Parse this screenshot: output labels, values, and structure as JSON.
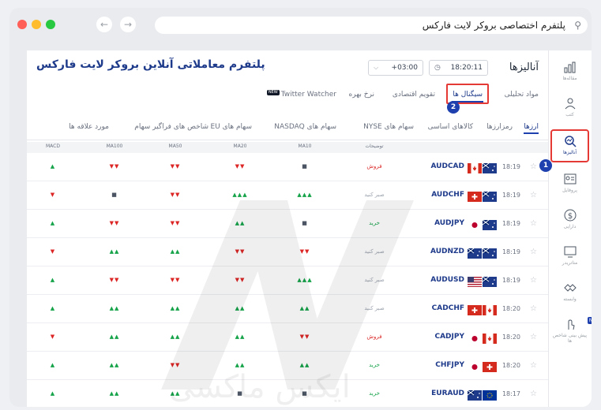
{
  "browser": {
    "url_text": "پلتفرم اختصاصی بروکر لایت فارکس",
    "dots": [
      "#ff5f57",
      "#febc2e",
      "#28c840"
    ]
  },
  "sidebar": {
    "items": [
      {
        "icon": "chart-bars-icon",
        "label": "مقاله‌ها"
      },
      {
        "icon": "book-icon",
        "label": "کتب"
      },
      {
        "icon": "analysis-icon",
        "label": "آنالیزها"
      },
      {
        "icon": "profile-card-icon",
        "label": "پروفایل"
      },
      {
        "icon": "dollar-coin-icon",
        "label": "دارایی"
      },
      {
        "icon": "monitor-icon",
        "label": "متاتریدر"
      },
      {
        "icon": "handshake-icon",
        "label": "وابسته"
      },
      {
        "icon": "touch-icon",
        "label": "پیش بینی شاخص ها"
      }
    ],
    "new_badge": "Ne",
    "step1": "1"
  },
  "header": {
    "title": "آنالیزها",
    "time": "18:20:11",
    "timezone": "03:00+",
    "brand": "پلتفرم معاملاتی آنلاین بروکر لایت فارکس"
  },
  "main_tabs": {
    "tabs": [
      "مواد تحلیلی",
      "سیگنال ها",
      "تقویم اقتصادی",
      "نرخ بهره",
      "Twitter Watcher"
    ],
    "new_label": "NEW",
    "step2": "2"
  },
  "sub_tabs": [
    "ارزها",
    "رمزارزها",
    "کالاهای اساسی",
    "سهام های NYSE",
    "سهام های NASDAQ",
    "سهام های EU",
    "شاخص های فراگیر سهام",
    "مورد علاقه ها"
  ],
  "table": {
    "headers": {
      "signal": "توضیحات",
      "ma10": "MA10",
      "ma20": "MA20",
      "ma50": "MA50",
      "ma100": "MA100",
      "macd": "MACD"
    },
    "rows": [
      {
        "time": "18:19",
        "symbol": "AUDCAD",
        "signal": "فروش",
        "ma10": "■",
        "ma20": "▼▼",
        "ma50": "▼▼",
        "ma100": "▼▼",
        "macd": "▲"
      },
      {
        "time": "18:19",
        "symbol": "AUDCHF",
        "signal": "صبر کنید",
        "ma10": "▲▲▲",
        "ma20": "▲▲▲",
        "ma50": "▼▼",
        "ma100": "■",
        "macd": "▼"
      },
      {
        "time": "18:19",
        "symbol": "AUDJPY",
        "signal": "خرید",
        "ma10": "■",
        "ma20": "▲▲",
        "ma50": "▼▼",
        "ma100": "▼▼",
        "macd": "▲"
      },
      {
        "time": "18:19",
        "symbol": "AUDNZD",
        "signal": "صبر کنید",
        "ma10": "▼▼",
        "ma20": "▼▼",
        "ma50": "▲▲",
        "ma100": "▲▲",
        "macd": "▼"
      },
      {
        "time": "18:19",
        "symbol": "AUDUSD",
        "signal": "صبر کنید",
        "ma10": "▲▲▲",
        "ma20": "▼▼",
        "ma50": "▼▼",
        "ma100": "▼▼",
        "macd": "▲"
      },
      {
        "time": "18:20",
        "symbol": "CADCHF",
        "signal": "صبر کنید",
        "ma10": "▲▲",
        "ma20": "▲▲",
        "ma50": "▲▲",
        "ma100": "▲▲",
        "macd": "▲"
      },
      {
        "time": "18:20",
        "symbol": "CADJPY",
        "signal": "فروش",
        "ma10": "▼▼",
        "ma20": "▲▲",
        "ma50": "▲▲",
        "ma100": "▲▲",
        "macd": "▼"
      },
      {
        "time": "18:20",
        "symbol": "CHFJPY",
        "signal": "خرید",
        "ma10": "▲▲",
        "ma20": "▲▲",
        "ma50": "▼▼",
        "ma100": "▲▲",
        "macd": "▲"
      },
      {
        "time": "18:17",
        "symbol": "EURAUD",
        "signal": "خرید",
        "ma10": "■",
        "ma20": "■",
        "ma50": "▲▲",
        "ma100": "▲▲",
        "macd": "▲"
      }
    ]
  },
  "watermark_text": "ایکس ماکسی"
}
